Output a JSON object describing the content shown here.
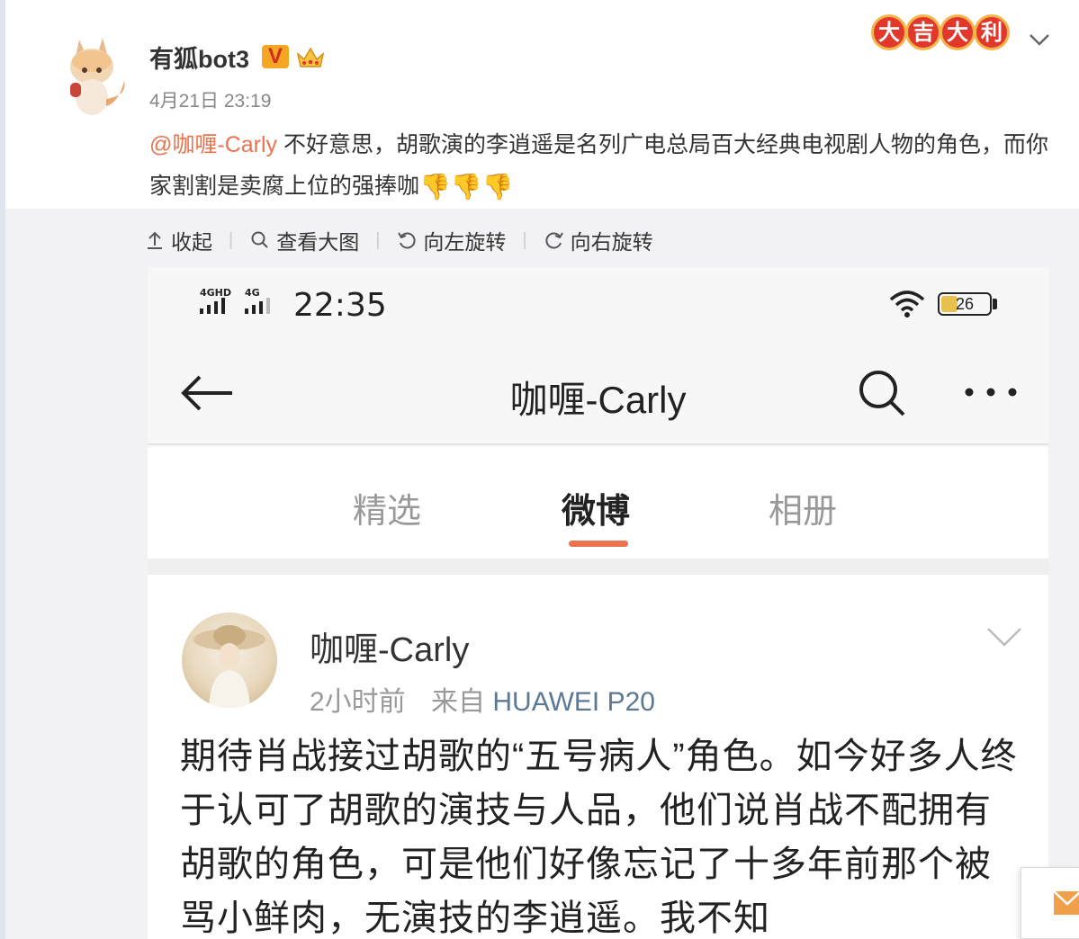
{
  "post": {
    "username": "有狐bot3",
    "verified_badge": "V",
    "time": "4月21日 23:19",
    "mention": "@咖喱-Carly",
    "text": " 不好意思，胡歌演的李逍遥是名列广电总局百大经典电视剧人物的角色，而你家割割是卖腐上位的强捧咖",
    "thumbs": "👎👎👎",
    "festive_chars": [
      "大",
      "吉",
      "大",
      "利"
    ],
    "icons": {
      "avatar": "fox-avatar-icon",
      "crown": "crown-icon",
      "menu": "chevron-down-icon"
    }
  },
  "toolbar": {
    "collapse": "收起",
    "view_large": "查看大图",
    "rotate_left": "向左旋转",
    "rotate_right": "向右旋转"
  },
  "screenshot": {
    "status": {
      "time": "22:35",
      "net1": "4GHD",
      "net2": "4G",
      "battery": "26"
    },
    "nav_title": "咖喱-Carly",
    "tabs": [
      "精选",
      "微博",
      "相册"
    ],
    "active_tab": "微博",
    "card": {
      "name": "咖喱-Carly",
      "time": "2小时前",
      "from_label": "来自",
      "device": "HUAWEI P20",
      "text": "期待肖战接过胡歌的“五号病人”角色。如今好多人终于认可了胡歌的演技与人品，他们说肖战不配拥有胡歌的角色，可是他们好像忘记了十多年前那个被骂小鲜肉，无演技的李逍遥。我不知"
    }
  },
  "colors": {
    "accent": "#eb7350",
    "link": "#5d7895",
    "festive": "#e1382b"
  }
}
